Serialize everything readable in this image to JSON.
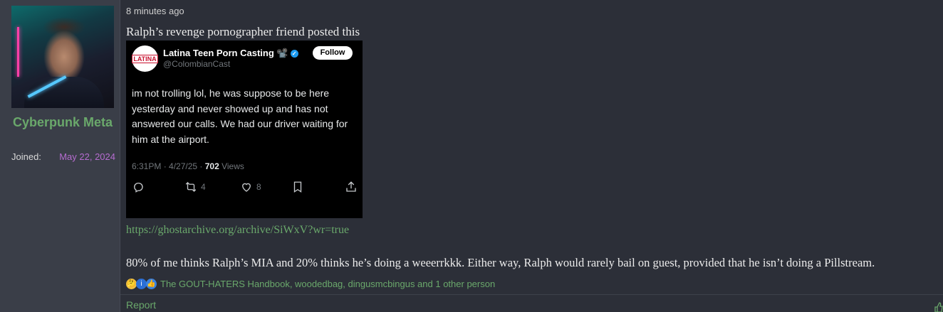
{
  "user": {
    "name": "Cyberpunk Meta",
    "joined_label": "Joined:",
    "joined_date": "May 22, 2024"
  },
  "post": {
    "time": "8 minutes ago",
    "intro": "Ralph’s revenge pornographer friend posted this",
    "link": "https://ghostarchive.org/archive/SiWxV?wr=true",
    "body": "80% of me thinks Ralph’s MIA and 20% thinks he’s doing a weeerrkkk. Either way, Ralph would rarely bail on guest, provided that he isn’t doing a Pillstream."
  },
  "tweet": {
    "logo_text": "LATINA",
    "account_name": "Latina Teen Porn Casting 📽️",
    "handle": "@ColombianCast",
    "follow_label": "Follow",
    "text": "im not trolling lol, he was suppose to be here yesterday and never showed up and has not answered our calls. We had our driver waiting for him at the airport.",
    "time": "6:31PM · 4/27/25 · ",
    "views_count": "702",
    "views_label": " Views",
    "retweets": "4",
    "likes": "8",
    "icons": [
      "reply-icon",
      "retweet-icon",
      "heart-icon",
      "bookmark-icon",
      "share-icon"
    ]
  },
  "reactions": {
    "emojis": [
      "🤔",
      "i",
      "👍"
    ],
    "names": "The GOUT-HATERS Handbook, woodedbag, dingusmcbingus and 1 other person"
  },
  "actions": {
    "report_label": "Report"
  },
  "colors": {
    "accent_green": "#6aa86b",
    "joined_date": "#b56ccf",
    "background": "#2c2f38",
    "sidebar": "#3a3e48"
  }
}
